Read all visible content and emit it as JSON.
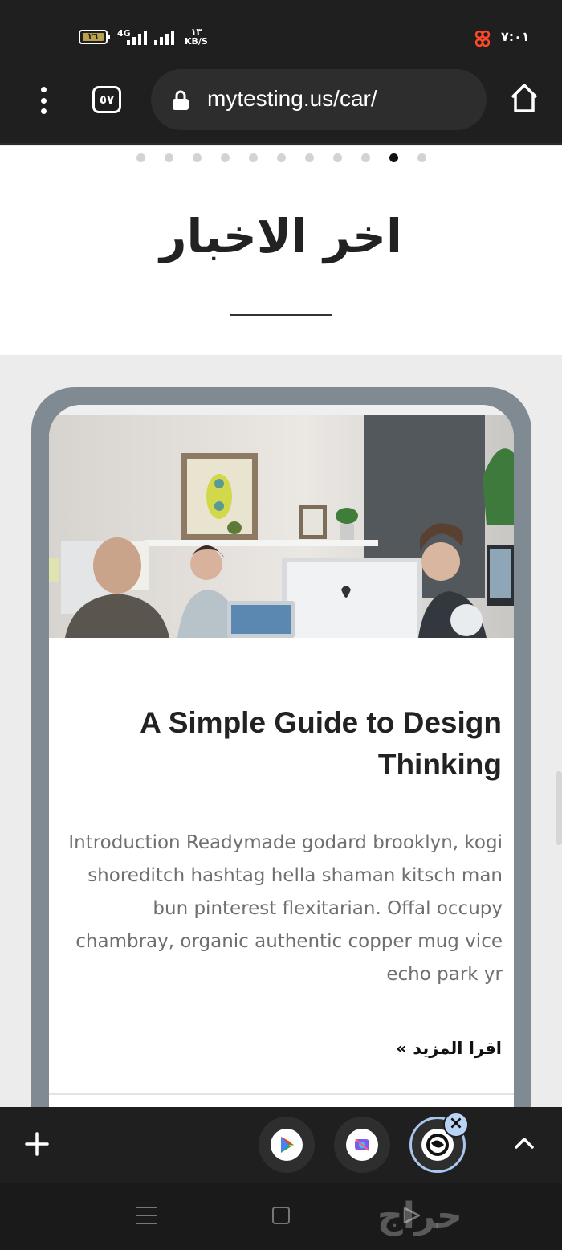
{
  "status_bar": {
    "battery_level": "٢٦",
    "network_type": "4G",
    "data_speed_value": "١٣",
    "data_speed_unit": "KB/S",
    "time": "٧:٠١",
    "notification_icon": "app-notification-icon"
  },
  "browser": {
    "url": "mytesting.us/car/",
    "tab_count": "٥٧",
    "menu_icon": "more-vert-icon",
    "lock_icon": "lock-icon",
    "home_icon": "home-icon"
  },
  "page": {
    "carousel": {
      "total_dots": 11,
      "active_index": 9
    },
    "section_title": "اخر الاخبار",
    "card": {
      "image_description": "office-team-photo",
      "title": "A Simple Guide to Design Thinking",
      "excerpt": "Introduction Readymade godard brooklyn, kogi shoreditch hashtag hella shaman kitsch man bun pinterest flexitarian. Offal occupy chambray, organic authentic copper mug vice echo park yr",
      "read_more": "اقرا المزيد »"
    }
  },
  "bottom_bar": {
    "new_tab_icon": "plus-icon",
    "quick_apps": [
      {
        "name": "google-play-icon"
      },
      {
        "name": "camera-app-icon"
      },
      {
        "name": "browser-app-icon",
        "active": true
      }
    ],
    "close_label": "×",
    "expand_icon": "chevron-up-icon"
  },
  "nav_bar": {
    "watermark": "حراج"
  },
  "colors": {
    "chrome_bg": "#1f1f1f",
    "card_frame": "#7f8a92",
    "page_bg": "#ececec",
    "active_dot": "#111111",
    "accent_badge": "#b9d3f5"
  }
}
